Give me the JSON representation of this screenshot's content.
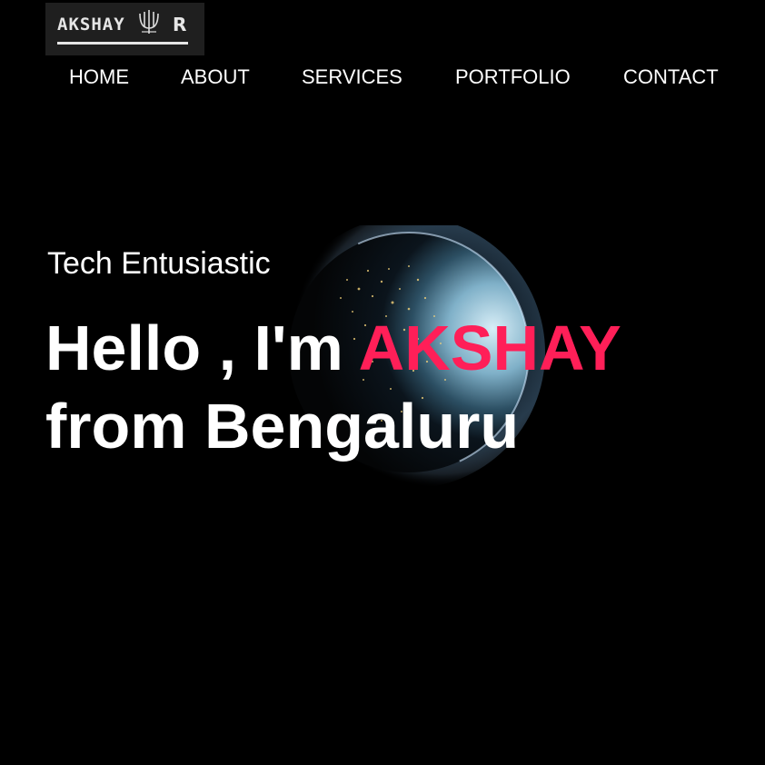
{
  "logo": {
    "text": "AKSHAY",
    "initial": "R",
    "mark_icon": "signature-emblem-icon"
  },
  "nav": {
    "items": [
      {
        "label": "HOME"
      },
      {
        "label": "ABOUT"
      },
      {
        "label": "SERVICES"
      },
      {
        "label": "PORTFOLIO"
      },
      {
        "label": "CONTACT"
      }
    ]
  },
  "hero": {
    "tagline": "Tech Entusiastic",
    "greeting": "Hello , I'm ",
    "name": "AKSHAY",
    "location_line": "from Bengaluru",
    "background_image": "earth-at-night-image"
  },
  "colors": {
    "background": "#000000",
    "text": "#ffffff",
    "accent": "#ff1f58",
    "logo_bg": "#1f1f1f"
  }
}
